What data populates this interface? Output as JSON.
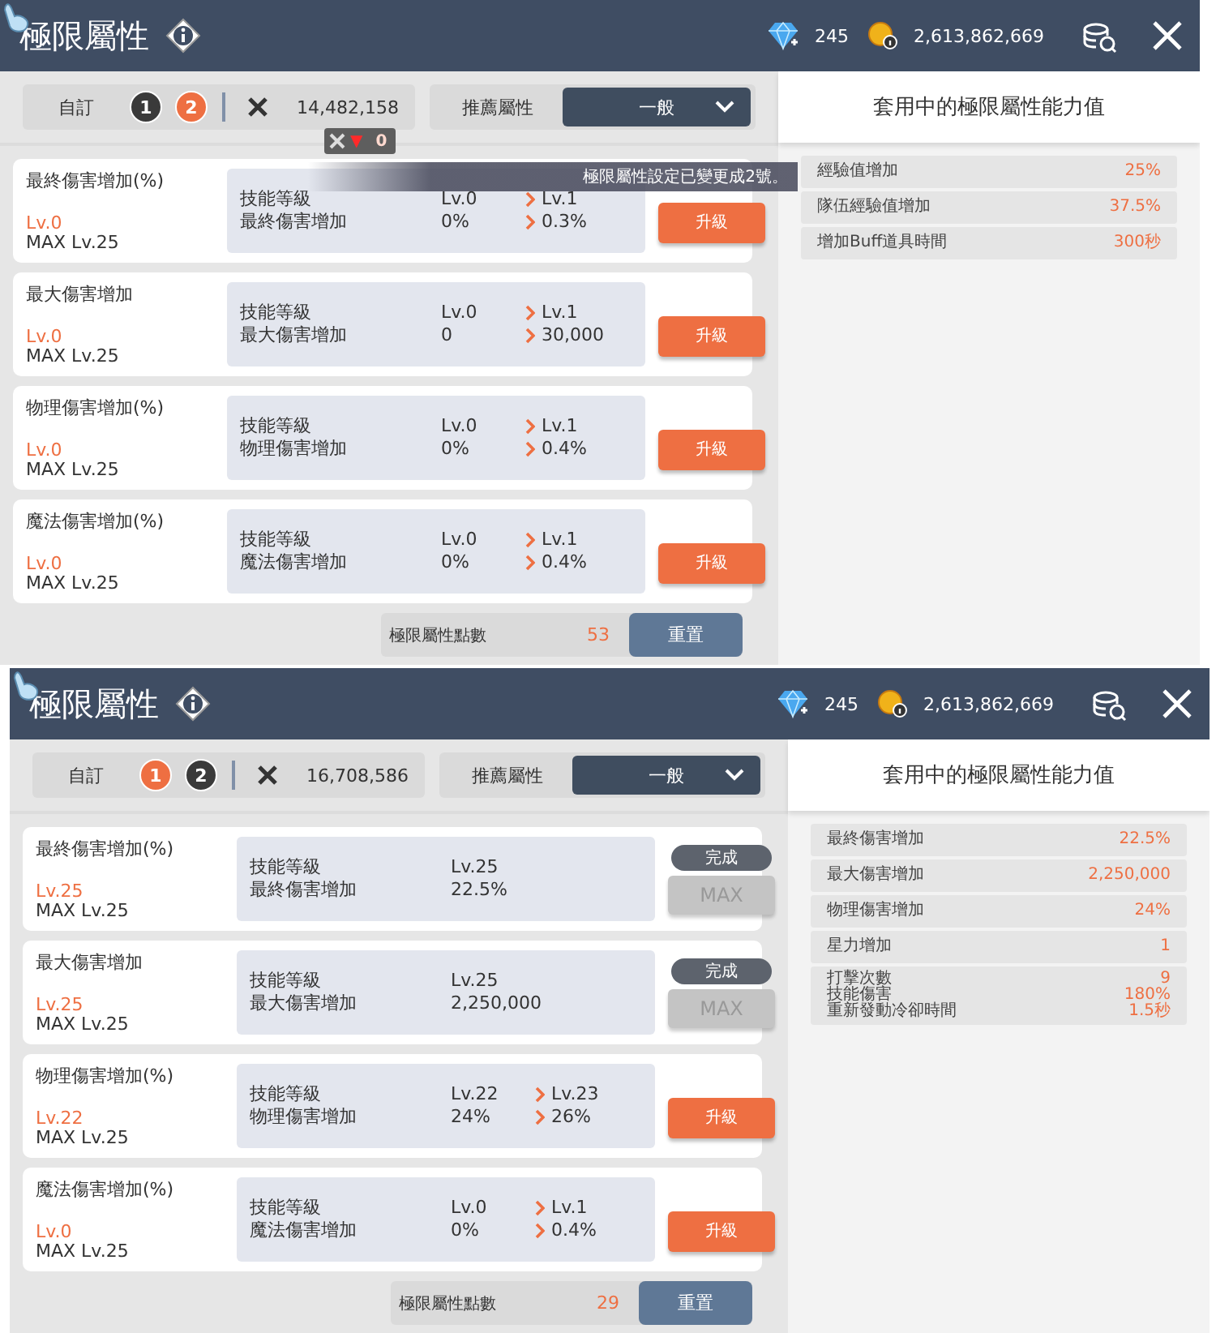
{
  "screens": [
    {
      "header": {
        "title": "極限屬性",
        "gems": "245",
        "mesos": "2,613,862,669"
      },
      "presets": {
        "label": "自訂",
        "slots": [
          {
            "label": "1",
            "selected": false
          },
          {
            "label": "2",
            "selected": true
          }
        ],
        "cost": "14,482,158"
      },
      "cost_change": {
        "arrow": "▼",
        "value": "0"
      },
      "recommend": {
        "label": "推薦屬性",
        "value": "一般"
      },
      "toast": "極限屬性設定已變更成2號。",
      "stats": [
        {
          "name": "最終傷害增加(%)",
          "level": "Lv.0",
          "max": "MAX Lv.25",
          "rows": [
            {
              "label": "技能等級",
              "current": "Lv.0",
              "next": "Lv.1"
            },
            {
              "label": "最終傷害增加",
              "current": "0%",
              "next": "0.3%"
            }
          ],
          "button": {
            "kind": "upgrade",
            "label": "升級"
          }
        },
        {
          "name": "最大傷害增加",
          "level": "Lv.0",
          "max": "MAX Lv.25",
          "rows": [
            {
              "label": "技能等級",
              "current": "Lv.0",
              "next": "Lv.1"
            },
            {
              "label": "最大傷害增加",
              "current": "0",
              "next": "30,000"
            }
          ],
          "button": {
            "kind": "upgrade",
            "label": "升級"
          }
        },
        {
          "name": "物理傷害增加(%)",
          "level": "Lv.0",
          "max": "MAX Lv.25",
          "rows": [
            {
              "label": "技能等級",
              "current": "Lv.0",
              "next": "Lv.1"
            },
            {
              "label": "物理傷害增加",
              "current": "0%",
              "next": "0.4%"
            }
          ],
          "button": {
            "kind": "upgrade",
            "label": "升級"
          }
        },
        {
          "name": "魔法傷害增加(%)",
          "level": "Lv.0",
          "max": "MAX Lv.25",
          "rows": [
            {
              "label": "技能等級",
              "current": "Lv.0",
              "next": "Lv.1"
            },
            {
              "label": "魔法傷害增加",
              "current": "0%",
              "next": "0.4%"
            }
          ],
          "button": {
            "kind": "upgrade",
            "label": "升級"
          }
        }
      ],
      "points": {
        "label": "極限屬性點數",
        "value": "53"
      },
      "reset": "重置",
      "summary": {
        "title": "套用中的極限屬性能力值",
        "rows": [
          {
            "lines": [
              {
                "label": "經驗值增加",
                "value": "25%"
              }
            ]
          },
          {
            "lines": [
              {
                "label": "隊伍經驗值增加",
                "value": "37.5%"
              }
            ]
          },
          {
            "lines": [
              {
                "label": "增加Buff道具時間",
                "value": "300秒"
              }
            ]
          }
        ]
      }
    },
    {
      "header": {
        "title": "極限屬性",
        "gems": "245",
        "mesos": "2,613,862,669"
      },
      "presets": {
        "label": "自訂",
        "slots": [
          {
            "label": "1",
            "selected": true
          },
          {
            "label": "2",
            "selected": false
          }
        ],
        "cost": "16,708,586"
      },
      "recommend": {
        "label": "推薦屬性",
        "value": "一般"
      },
      "stats": [
        {
          "name": "最終傷害增加(%)",
          "level": "Lv.25",
          "max": "MAX Lv.25",
          "rows": [
            {
              "label": "技能等級",
              "current": "Lv.25"
            },
            {
              "label": "最終傷害增加",
              "current": "22.5%"
            }
          ],
          "button": {
            "kind": "max",
            "status": "完成",
            "label": "MAX"
          }
        },
        {
          "name": "最大傷害增加",
          "level": "Lv.25",
          "max": "MAX Lv.25",
          "rows": [
            {
              "label": "技能等級",
              "current": "Lv.25"
            },
            {
              "label": "最大傷害增加",
              "current": "2,250,000"
            }
          ],
          "button": {
            "kind": "max",
            "status": "完成",
            "label": "MAX"
          }
        },
        {
          "name": "物理傷害增加(%)",
          "level": "Lv.22",
          "max": "MAX Lv.25",
          "rows": [
            {
              "label": "技能等級",
              "current": "Lv.22",
              "next": "Lv.23"
            },
            {
              "label": "物理傷害增加",
              "current": "24%",
              "next": "26%"
            }
          ],
          "button": {
            "kind": "upgrade",
            "label": "升級"
          }
        },
        {
          "name": "魔法傷害增加(%)",
          "level": "Lv.0",
          "max": "MAX Lv.25",
          "rows": [
            {
              "label": "技能等級",
              "current": "Lv.0",
              "next": "Lv.1"
            },
            {
              "label": "魔法傷害增加",
              "current": "0%",
              "next": "0.4%"
            }
          ],
          "button": {
            "kind": "upgrade",
            "label": "升級"
          }
        }
      ],
      "points": {
        "label": "極限屬性點數",
        "value": "29"
      },
      "reset": "重置",
      "summary": {
        "title": "套用中的極限屬性能力值",
        "rows": [
          {
            "lines": [
              {
                "label": "最終傷害增加",
                "value": "22.5%"
              }
            ]
          },
          {
            "lines": [
              {
                "label": "最大傷害增加",
                "value": "2,250,000"
              }
            ]
          },
          {
            "lines": [
              {
                "label": "物理傷害增加",
                "value": "24%"
              }
            ]
          },
          {
            "lines": [
              {
                "label": "星力增加",
                "value": "1"
              }
            ]
          },
          {
            "lines": [
              {
                "label": "打擊次數",
                "value": "9"
              },
              {
                "label": "技能傷害",
                "value": "180%"
              },
              {
                "label": "重新發動冷卻時間",
                "value": "1.5秒"
              }
            ]
          }
        ]
      }
    }
  ]
}
